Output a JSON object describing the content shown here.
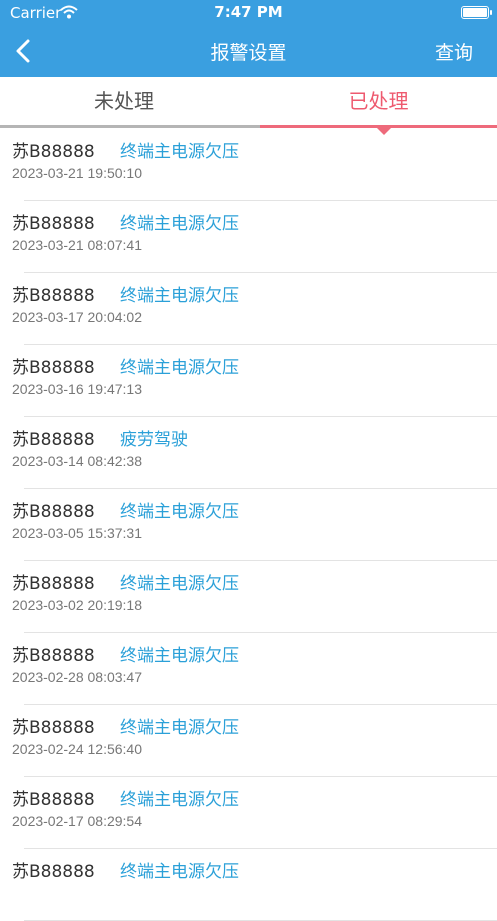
{
  "statusbar": {
    "carrier": "Carrier",
    "time": "7:47 PM"
  },
  "navbar": {
    "title": "报警设置",
    "query": "查询"
  },
  "tabs": {
    "unprocessed": "未处理",
    "processed": "已处理",
    "active": "processed"
  },
  "colors": {
    "header": "#3a9fe0",
    "active_tab": "#ee5a6f",
    "alarm_type": "#2ba0d8"
  },
  "alarms": [
    {
      "plate": "苏B88888",
      "type": "终端主电源欠压",
      "time": "2023-03-21 19:50:10"
    },
    {
      "plate": "苏B88888",
      "type": "终端主电源欠压",
      "time": "2023-03-21 08:07:41"
    },
    {
      "plate": "苏B88888",
      "type": "终端主电源欠压",
      "time": "2023-03-17 20:04:02"
    },
    {
      "plate": "苏B88888",
      "type": "终端主电源欠压",
      "time": "2023-03-16 19:47:13"
    },
    {
      "plate": "苏B88888",
      "type": "疲劳驾驶",
      "time": "2023-03-14 08:42:38"
    },
    {
      "plate": "苏B88888",
      "type": "终端主电源欠压",
      "time": "2023-03-05 15:37:31"
    },
    {
      "plate": "苏B88888",
      "type": "终端主电源欠压",
      "time": "2023-03-02 20:19:18"
    },
    {
      "plate": "苏B88888",
      "type": "终端主电源欠压",
      "time": "2023-02-28 08:03:47"
    },
    {
      "plate": "苏B88888",
      "type": "终端主电源欠压",
      "time": "2023-02-24 12:56:40"
    },
    {
      "plate": "苏B88888",
      "type": "终端主电源欠压",
      "time": "2023-02-17 08:29:54"
    },
    {
      "plate": "苏B88888",
      "type": "终端主电源欠压",
      "time": ""
    }
  ]
}
